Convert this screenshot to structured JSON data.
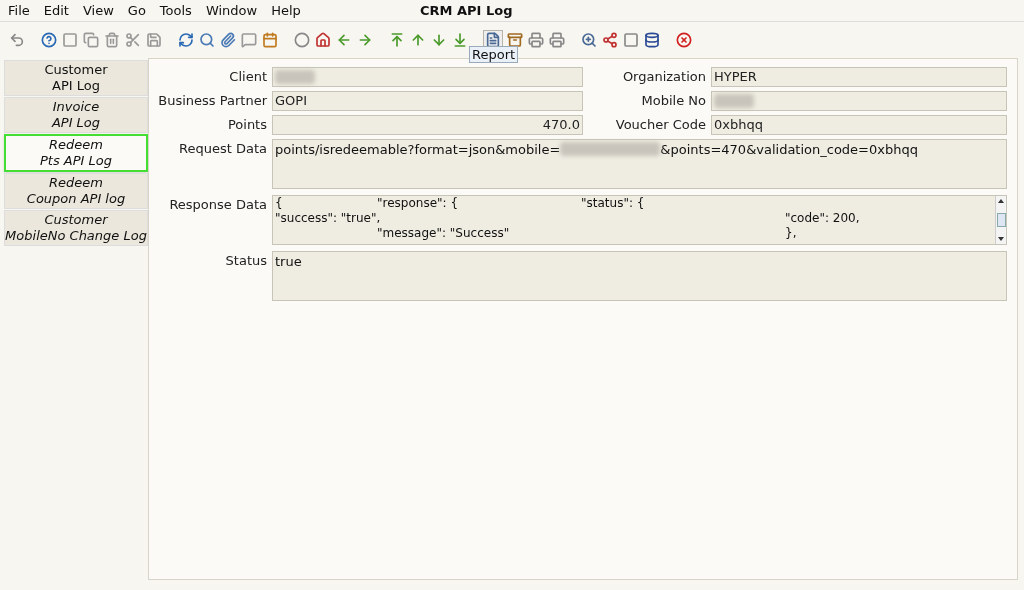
{
  "window": {
    "title": "CRM API Log"
  },
  "menu": [
    "File",
    "Edit",
    "View",
    "Go",
    "Tools",
    "Window",
    "Help"
  ],
  "toolbar": {
    "tooltip": "Report"
  },
  "sidebar": {
    "items": [
      {
        "lines": [
          "Customer",
          "API Log"
        ],
        "italic": false,
        "selected": false
      },
      {
        "lines": [
          "Invoice",
          "API Log"
        ],
        "italic": true,
        "selected": false
      },
      {
        "lines": [
          "Redeem",
          "Pts API Log"
        ],
        "italic": true,
        "selected": true
      },
      {
        "lines": [
          "Redeem",
          "Coupon API log"
        ],
        "italic": true,
        "selected": false
      },
      {
        "lines": [
          "Customer",
          "MobileNo Change Log"
        ],
        "italic": true,
        "selected": false
      }
    ]
  },
  "form": {
    "client": {
      "label": "Client",
      "redacted": true
    },
    "organization": {
      "label": "Organization",
      "value": "HYPER"
    },
    "business_partner": {
      "label": "Business Partner",
      "value": "GOPI"
    },
    "mobile_no": {
      "label": "Mobile No",
      "redacted": true
    },
    "points": {
      "label": "Points",
      "value": "470.0"
    },
    "voucher_code": {
      "label": "Voucher Code",
      "value": "0xbhqq"
    },
    "request_data": {
      "label": "Request Data",
      "before": "points/isredeemable?format=json&mobile=",
      "after": "&points=470&validation_code=0xbhqq"
    },
    "response_data": {
      "label": "Response Data",
      "lines": [
        "{\t\"response\": {\t\t\"status\": {",
        "\"success\": \"true\",\t\t\t\t\"code\": 200,",
        "\t\"message\": \"Success\"\t\t\t},"
      ]
    },
    "status": {
      "label": "Status",
      "value": "true"
    }
  }
}
